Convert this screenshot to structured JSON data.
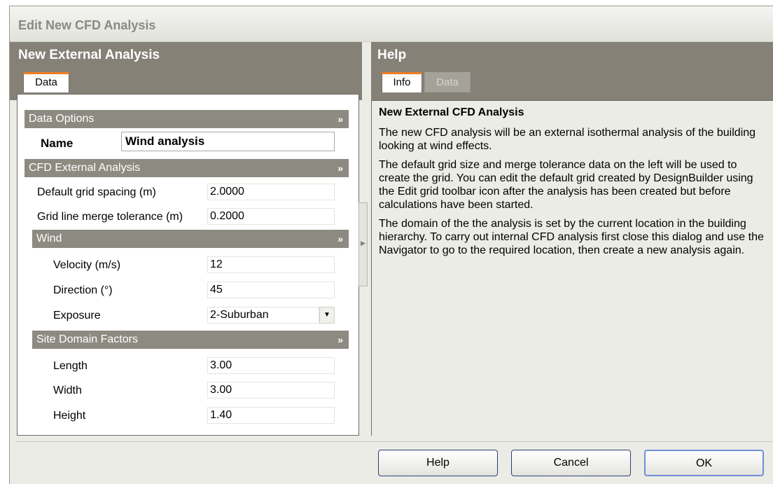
{
  "window": {
    "title": "Edit New CFD Analysis"
  },
  "left_panel": {
    "title": "New External Analysis",
    "tabs": [
      {
        "label": "Data",
        "active": true
      }
    ],
    "sections": {
      "data_options": {
        "label": "Data Options",
        "name_label": "Name",
        "name_value": "Wind analysis"
      },
      "cfd_external": {
        "label": "CFD External Analysis",
        "grid_spacing_label": "Default grid spacing (m)",
        "grid_spacing_value": "2.0000",
        "merge_tol_label": "Grid line merge tolerance (m)",
        "merge_tol_value": "0.2000"
      },
      "wind": {
        "label": "Wind",
        "velocity_label": "Velocity (m/s)",
        "velocity_value": "12",
        "direction_label": "Direction (°)",
        "direction_value": "45",
        "exposure_label": "Exposure",
        "exposure_value": "2-Suburban"
      },
      "site_domain": {
        "label": "Site Domain Factors",
        "length_label": "Length",
        "length_value": "3.00",
        "width_label": "Width",
        "width_value": "3.00",
        "height_label": "Height",
        "height_value": "1.40"
      }
    },
    "collapse_glyph": "»"
  },
  "help_panel": {
    "title": "Help",
    "tabs": [
      {
        "label": "Info",
        "active": true
      },
      {
        "label": "Data",
        "active": false
      }
    ],
    "heading": "New External CFD Analysis",
    "paragraphs": [
      "The new CFD analysis will be an external isothermal analysis of the building looking at wind effects.",
      "The default grid size and merge tolerance data on the left will be used to create the grid. You can edit the default grid created by DesignBuilder using the Edit grid toolbar icon after the analysis has been created but before calculations have been started.",
      "The domain of the the analysis is set by the current location in the building hierarchy. To carry out internal CFD analysis first close this dialog and use the Navigator to go to the required location, then create a new analysis again."
    ]
  },
  "buttons": {
    "help": "Help",
    "cancel": "Cancel",
    "ok": "OK"
  },
  "colors": {
    "header_bg": "#858177",
    "section_bg": "#8d8a81",
    "tab_accent": "#ef7d20",
    "button_border": "#2e3d7a"
  }
}
